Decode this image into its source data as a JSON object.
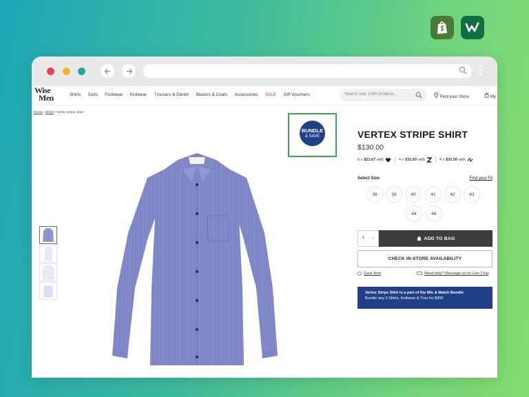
{
  "browser": {
    "window_controls": [
      "close",
      "minimize",
      "maximize"
    ],
    "nav_icons": [
      "arrow-left-icon",
      "arrow-right-icon"
    ],
    "url": ""
  },
  "apps": [
    "shopify-icon",
    "wiser-app-icon"
  ],
  "site": {
    "logo": {
      "line1": "Wise",
      "line2": "Men"
    },
    "nav": [
      "Shirts",
      "Suits",
      "Footwear",
      "Knitwear",
      "Trousers & Denim",
      "Blazers & Coats",
      "Accessories",
      "SALE",
      "Gift Vouchers"
    ],
    "search_placeholder": "Search over 1000 products...",
    "find_store": "Find your Store",
    "my_bag": "My"
  },
  "breadcrumb": {
    "home": "Home",
    "sep": "/",
    "shirts": "Shirts",
    "current": "Vertex Stripe Shirt"
  },
  "badge": {
    "line1": "BUNDLE",
    "line2": "& SAVE"
  },
  "product": {
    "title": "VERTEX STRIPE SHIRT",
    "price": "$130.00",
    "installments": [
      {
        "count": "6 x",
        "amount": "$21.67",
        "with": "with",
        "provider_icon": "heart-icon"
      },
      {
        "count": "4 x",
        "amount": "$32.50",
        "with": "with",
        "provider_icon": "zip-icon"
      },
      {
        "count": "4 x",
        "amount": "$32.50",
        "with": "with",
        "provider_icon": "afterpay-icon"
      }
    ],
    "select_size_label": "Select Size:",
    "find_fit_link": "Find your Fit",
    "sizes": [
      "38",
      "39",
      "40",
      "41",
      "42",
      "43",
      "44",
      "46"
    ],
    "quantity": "1",
    "add_to_bag": "ADD TO BAG",
    "check_store": "CHECK IN-STORE AVAILABILITY",
    "save_item": "Save Item",
    "help": "Need help? Message us on Live Chat",
    "bundle_line1": "Vertex Stripe Shirt is a part of the Mix & Match Bundle",
    "bundle_line2": "Bundle any 3 Shirts, Knitwear & Trou for $300"
  },
  "colors": {
    "accent_navy": "#1f3f86",
    "sale_red": "#d8232a",
    "frame_green": "#3aa54a",
    "button_dark": "#3d3d3d"
  }
}
